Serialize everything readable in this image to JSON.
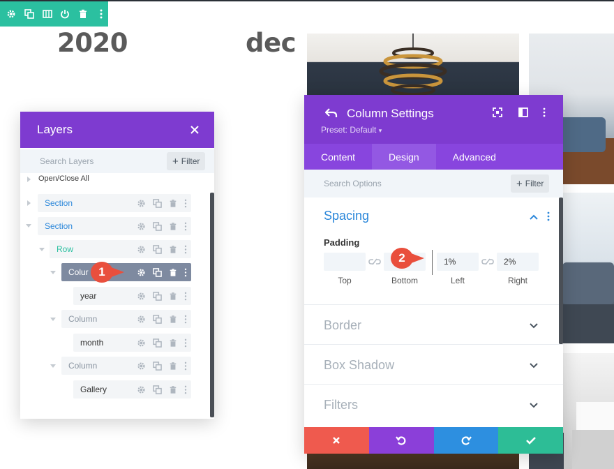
{
  "canvas": {
    "year_text": "2020",
    "month_text": "dec"
  },
  "module_toolbar": {
    "icons": [
      "gear-icon",
      "duplicate-icon",
      "columns-icon",
      "power-icon",
      "trash-icon",
      "more-icon"
    ],
    "color": "#2bc0a0"
  },
  "layers": {
    "title": "Layers",
    "search_placeholder": "Search Layers",
    "filter_label": "Filter",
    "open_close_all": "Open/Close All",
    "rows": [
      {
        "label": "Section"
      },
      {
        "label": "Section"
      },
      {
        "label": "Row"
      },
      {
        "label": "Colur"
      },
      {
        "label": "year"
      },
      {
        "label": "Column"
      },
      {
        "label": "month"
      },
      {
        "label": "Column"
      },
      {
        "label": "Gallery"
      }
    ]
  },
  "annotations": {
    "badge_1": "1",
    "badge_2": "2"
  },
  "settings": {
    "title": "Column Settings",
    "preset": "Preset: Default",
    "tabs": [
      {
        "label": "Content"
      },
      {
        "label": "Design",
        "selected": true
      },
      {
        "label": "Advanced"
      }
    ],
    "search_placeholder": "Search Options",
    "filter_label": "Filter",
    "sections": {
      "spacing": "Spacing",
      "border": "Border",
      "box_shadow": "Box Shadow",
      "filters": "Filters"
    },
    "padding": {
      "label": "Padding",
      "top_value": "",
      "bottom_value": "",
      "left_value": "1%",
      "right_value": "2%",
      "top_caption": "Top",
      "bottom_caption": "Bottom",
      "left_caption": "Left",
      "right_caption": "Right"
    },
    "footer_buttons": [
      {
        "icon": "close-icon",
        "color": "#ef5a4e"
      },
      {
        "icon": "undo-icon",
        "color": "#8b3fd9"
      },
      {
        "icon": "redo-icon",
        "color": "#2d8fe0"
      },
      {
        "icon": "check-icon",
        "color": "#2dbd96"
      }
    ]
  },
  "colors": {
    "purple_header": "#7e3bd0",
    "accent_blue": "#2b87da",
    "row_green": "#2bc0a0",
    "badge_red": "#e94f3d"
  }
}
